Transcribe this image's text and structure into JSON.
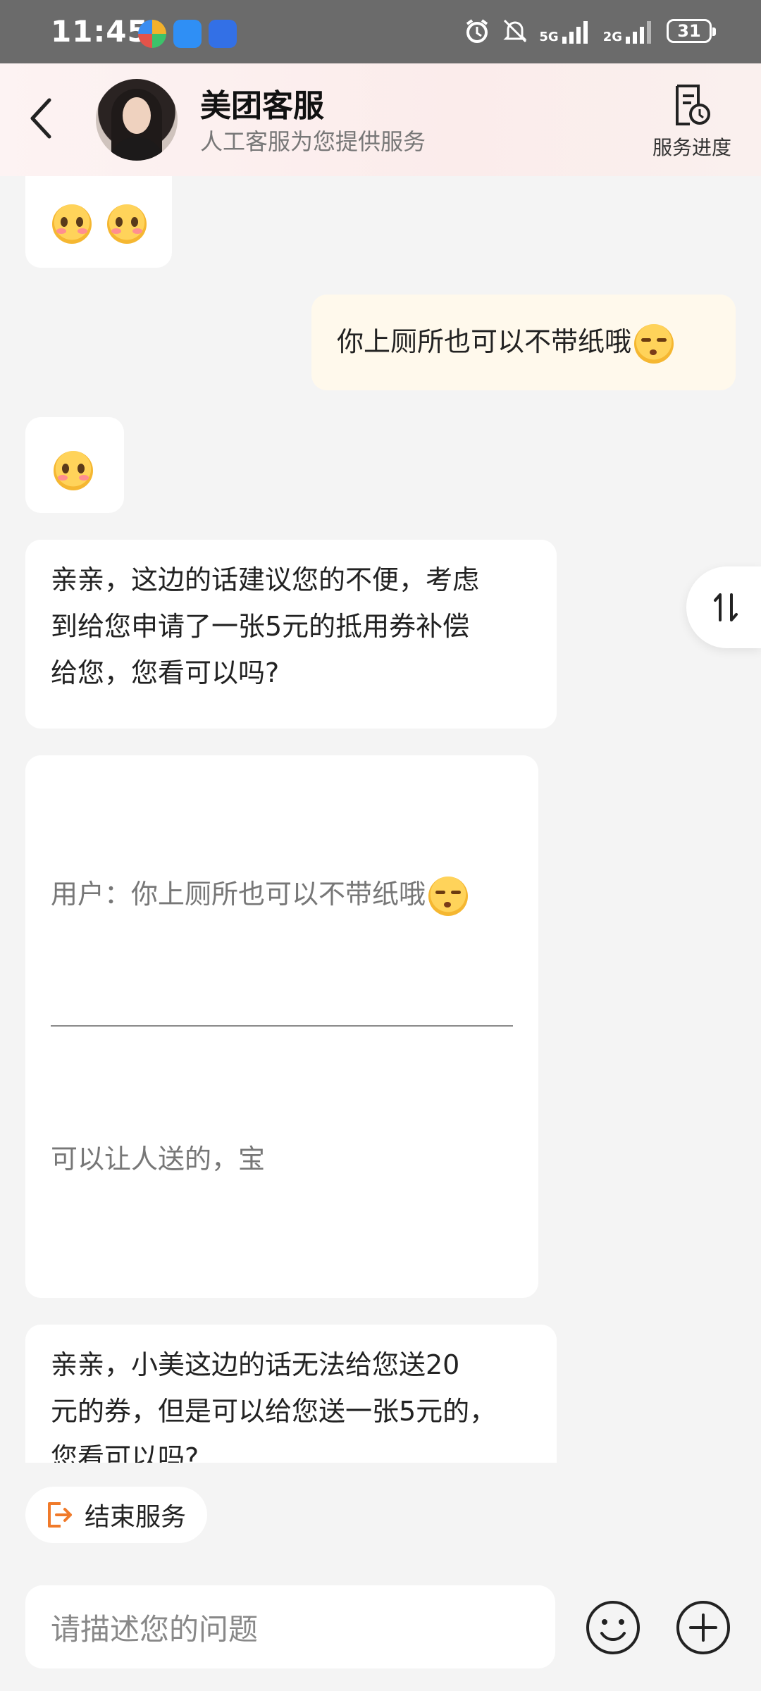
{
  "status_bar": {
    "time": "11:45",
    "network_1": "5G",
    "network_2": "2G",
    "battery": "31"
  },
  "header": {
    "title": "美团客服",
    "subtitle": "人工客服为您提供服务",
    "progress_label": "服务进度",
    "icons": {
      "back": "chevron-left-icon",
      "progress": "document-clock-icon"
    }
  },
  "messages": [
    {
      "from": "agent",
      "type": "emoji",
      "emojis": [
        "blush-emoji",
        "blush-emoji"
      ]
    },
    {
      "from": "user",
      "text": "你上厕所也可以不带纸哦",
      "emoji": "smirk-emoji"
    },
    {
      "from": "agent",
      "type": "emoji",
      "emojis": [
        "blush-emoji"
      ]
    },
    {
      "from": "agent",
      "text_lines": [
        "亲亲，这边的话建议您的不便，考虑",
        "到给您申请了一张5元的抵用券补偿",
        "给您，您看可以吗?"
      ]
    },
    {
      "from": "agent",
      "type": "quote",
      "quoted": "用户：你上厕所也可以不带纸哦",
      "reply": "可以让人送的，宝"
    },
    {
      "from": "agent",
      "text_lines": [
        "亲亲，小美这边的话无法给您送20",
        "元的券，但是可以给您送一张5元的，",
        "您看可以吗?"
      ]
    }
  ],
  "actions": {
    "end_service": "结束服务"
  },
  "input": {
    "placeholder": "请描述您的问题"
  },
  "colors": {
    "user_bubble": "#fff9ec",
    "agent_bubble": "#ffffff",
    "end_icon": "#f07a2a"
  }
}
